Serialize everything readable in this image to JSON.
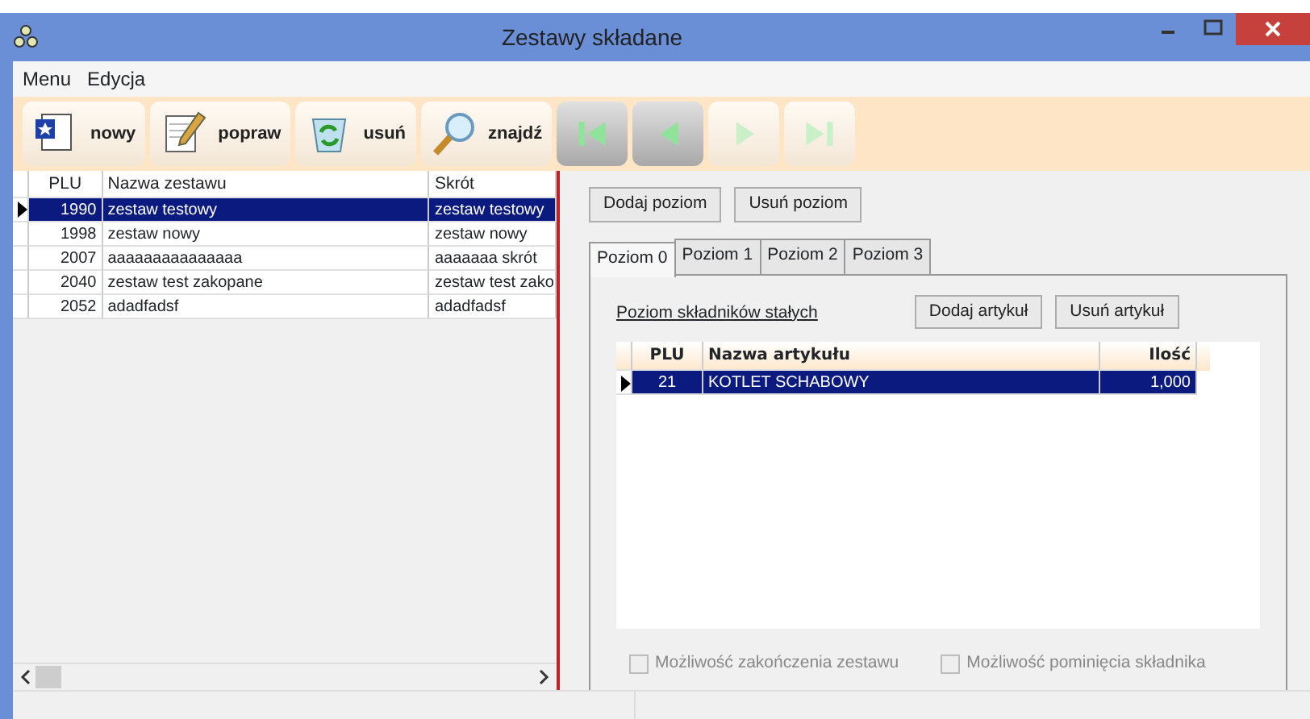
{
  "window": {
    "title": "Zestawy składane"
  },
  "menu": [
    "Menu",
    "Edycja"
  ],
  "toolbar": [
    {
      "kind": "new",
      "label": "nowy"
    },
    {
      "kind": "edit",
      "label": "popraw"
    },
    {
      "kind": "delete",
      "label": "usuń"
    },
    {
      "kind": "find",
      "label": "znajdź"
    }
  ],
  "navigation": [
    {
      "kind": "first",
      "disabled": false
    },
    {
      "kind": "prev",
      "disabled": false
    },
    {
      "kind": "next",
      "disabled": true
    },
    {
      "kind": "last",
      "disabled": true
    }
  ],
  "sets_table": {
    "columns": [
      "PLU",
      "Nazwa zestawu",
      "Skrót"
    ],
    "rows": [
      {
        "cells": [
          "1990",
          "zestaw testowy",
          "zestaw testowy"
        ],
        "selected": true
      },
      {
        "cells": [
          "1998",
          "zestaw nowy",
          "zestaw nowy"
        ],
        "selected": false
      },
      {
        "cells": [
          "2007",
          "aaaaaaaaaaaaaaa",
          "aaaaaaa skrót"
        ],
        "selected": false
      },
      {
        "cells": [
          "2040",
          "zestaw test zakopane",
          "zestaw test zako"
        ],
        "selected": false
      },
      {
        "cells": [
          "2052",
          "adadfadsf",
          "adadfadsf"
        ],
        "selected": false
      }
    ]
  },
  "level_buttons": [
    "Dodaj poziom",
    "Usuń poziom"
  ],
  "tabs": [
    {
      "label": "Poziom 0",
      "selected": true
    },
    {
      "label": "Poziom 1",
      "selected": false
    },
    {
      "label": "Poziom 2",
      "selected": false
    },
    {
      "label": "Poziom 3",
      "selected": false
    }
  ],
  "level_panel": {
    "caption": "Poziom składników stałych",
    "buttons": [
      "Dodaj artykuł",
      "Usuń artykuł"
    ],
    "columns": [
      "PLU",
      "Nazwa artykułu",
      "Ilość"
    ],
    "rows": [
      {
        "cells": [
          "21",
          "KOTLET SCHABOWY",
          "1,000"
        ],
        "selected": true
      }
    ],
    "options": [
      {
        "label": "Możliwość zakończenia zestawu",
        "checked": false,
        "disabled": true
      },
      {
        "label": "Możliwość pominięcia składnika",
        "checked": false,
        "disabled": true
      }
    ]
  }
}
